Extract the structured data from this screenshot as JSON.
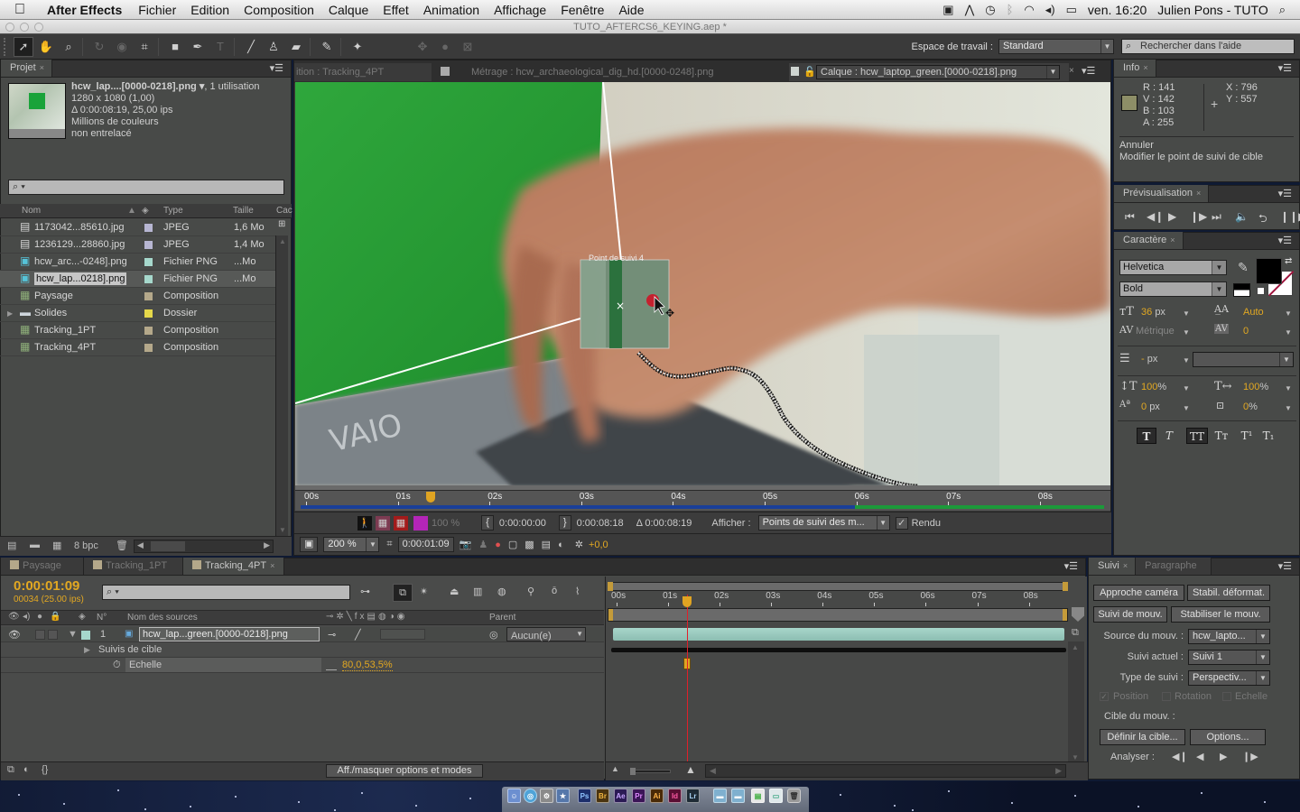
{
  "menubar": {
    "app": "After Effects",
    "items": [
      "Fichier",
      "Edition",
      "Composition",
      "Calque",
      "Effet",
      "Animation",
      "Affichage",
      "Fenêtre",
      "Aide"
    ],
    "clock": "ven. 16:20",
    "user": "Julien Pons - TUTO"
  },
  "window": {
    "title": "TUTO_AFTERCS6_KEYING.aep *"
  },
  "toolbar": {
    "workspace_label": "Espace de travail :",
    "workspace_value": "Standard",
    "help_search_placeholder": "Rechercher dans l'aide"
  },
  "project": {
    "tab": "Projet",
    "selected_file": {
      "name": "hcw_lap....[0000-0218].png ▾",
      "usage": ", 1 utilisation",
      "dimensions": "1280 x 1080 (1,00)",
      "duration": "Δ 0:00:08:19, 25,00 ips",
      "colors": "Millions de couleurs",
      "interlace": "non entrelacé"
    },
    "search_placeholder": "⌕ ▾",
    "columns": {
      "name": "Nom",
      "type": "Type",
      "size": "Taille",
      "cache": "Cac"
    },
    "items": [
      {
        "name": "1173042...85610.jpg",
        "type": "JPEG",
        "size": "1,6 Mo",
        "label": "#b7b6d2",
        "icon": "jpeg-file-icon"
      },
      {
        "name": "1236129...28860.jpg",
        "type": "JPEG",
        "size": "1,4 Mo",
        "label": "#b7b6d2",
        "icon": "jpeg-file-icon"
      },
      {
        "name": "hcw_arc...-0248].png",
        "type": "Fichier PNG",
        "size": "...Mo",
        "label": "#a6d8cc",
        "icon": "png-sequence-icon"
      },
      {
        "name": "hcw_lap...0218].png",
        "type": "Fichier PNG",
        "size": "...Mo",
        "label": "#a6d8cc",
        "icon": "png-sequence-icon",
        "selected": true
      },
      {
        "name": "Paysage",
        "type": "Composition",
        "size": "",
        "label": "#b4a88a",
        "icon": "composition-icon"
      },
      {
        "name": "Solides",
        "type": "Dossier",
        "size": "",
        "label": "#e5d84a",
        "icon": "folder-icon"
      },
      {
        "name": "Tracking_1PT",
        "type": "Composition",
        "size": "",
        "label": "#b4a88a",
        "icon": "composition-icon"
      },
      {
        "name": "Tracking_4PT",
        "type": "Composition",
        "size": "",
        "label": "#b4a88a",
        "icon": "composition-icon"
      }
    ],
    "bpc": "8 bpc"
  },
  "viewer": {
    "tabs": [
      {
        "label": "ition : Tracking_4PT",
        "active": false
      },
      {
        "label": "Métrage : hcw_archaeological_dig_hd.[0000-0248].png",
        "active": false
      },
      {
        "label": "Calque : hcw_laptop_green.[0000-0218].png",
        "active": true
      }
    ],
    "track_point_label": "Point de suivi 4",
    "ruler_ticks": [
      "00s",
      "01s",
      "02s",
      "03s",
      "04s",
      "05s",
      "06s",
      "07s",
      "08s"
    ],
    "playhead_seconds": 1.36,
    "duration_seconds": 8.76,
    "opacity": "100 %",
    "in_point": "0:00:00:00",
    "out_point": "0:00:08:18",
    "duration": "Δ 0:00:08:19",
    "show_label": "Afficher :",
    "show_value": "Points de suivi des m...",
    "render_label": "Rendu",
    "render_checked": true,
    "zoom": "200 %",
    "current_time": "0:00:01:09",
    "exposure": "+0,0"
  },
  "info": {
    "tab": "Info",
    "r": "R : 141",
    "v": "V : 142",
    "b": "B : 103",
    "a": "A : 255",
    "x": "X : 796",
    "y": "Y : 557",
    "swatch_color": "#8d8e67",
    "undo_label": "Annuler",
    "undo_action": "Modifier le point de suivi de cible"
  },
  "preview": {
    "tab": "Prévisualisation"
  },
  "character": {
    "tab": "Caractère",
    "font": "Helvetica",
    "style": "Bold",
    "size": "36",
    "size_unit": "px",
    "leading": "Auto",
    "kerning": "Métrique",
    "tracking": "0",
    "stroke_width": "-",
    "stroke_unit": "px",
    "vscale": "100",
    "hscale": "100",
    "pct": "%",
    "baseline": "0",
    "baseline_unit": "px",
    "tsume": "0",
    "fill_color": "#000000"
  },
  "timeline": {
    "tabs": [
      {
        "label": "Paysage",
        "active": false
      },
      {
        "label": "Tracking_1PT",
        "active": false
      },
      {
        "label": "Tracking_4PT",
        "active": true
      }
    ],
    "timecode": "0:00:01:09",
    "frame": "00034 (25.00 ips)",
    "search_placeholder": "⌕ ▾",
    "col_num": "N°",
    "col_source": "Nom des sources",
    "col_parent": "Parent",
    "layer": {
      "num": "1",
      "name": "hcw_lap...green.[0000-0218].png",
      "parent": "Aucun(e)"
    },
    "group": "Suivis de cible",
    "property": {
      "name": "Echelle",
      "value": "80,0,53,5%"
    },
    "ruler_ticks": [
      "00s",
      "01s",
      "02s",
      "03s",
      "04s",
      "05s",
      "06s",
      "07s",
      "08s"
    ],
    "toggle_button": "Aff./masquer options et modes"
  },
  "tracker": {
    "tabs": [
      {
        "label": "Suivi",
        "active": true
      },
      {
        "label": "Paragraphe",
        "active": false
      }
    ],
    "btn_camera": "Approche caméra",
    "btn_warp": "Stabil. déformat.",
    "btn_track": "Suivi de mouv.",
    "btn_stabilize": "Stabiliser le mouv.",
    "source_label": "Source du mouv. :",
    "source_value": "hcw_lapto...",
    "current_label": "Suivi actuel :",
    "current_value": "Suivi 1",
    "type_label": "Type de suivi :",
    "type_value": "Perspectiv...",
    "opt_position": "Position",
    "opt_rotation": "Rotation",
    "opt_scale": "Echelle",
    "target_label": "Cible du mouv. :",
    "btn_target": "Définir la cible...",
    "btn_options": "Options...",
    "analyze_label": "Analyser :"
  },
  "dock": {
    "apps": [
      {
        "label": "Ps",
        "bg": "#1d2f6b",
        "fg": "#8fc5ff"
      },
      {
        "label": "Br",
        "bg": "#4a3410",
        "fg": "#f2b640"
      },
      {
        "label": "Ae",
        "bg": "#2b1b55",
        "fg": "#c7a6ff"
      },
      {
        "label": "Pr",
        "bg": "#3b1657",
        "fg": "#e08aff"
      },
      {
        "label": "Ai",
        "bg": "#4a2a07",
        "fg": "#ffb54a"
      },
      {
        "label": "Id",
        "bg": "#5a0f33",
        "fg": "#ff5aa5"
      },
      {
        "label": "Lr",
        "bg": "#1e2b35",
        "fg": "#a9d2f2"
      }
    ]
  }
}
